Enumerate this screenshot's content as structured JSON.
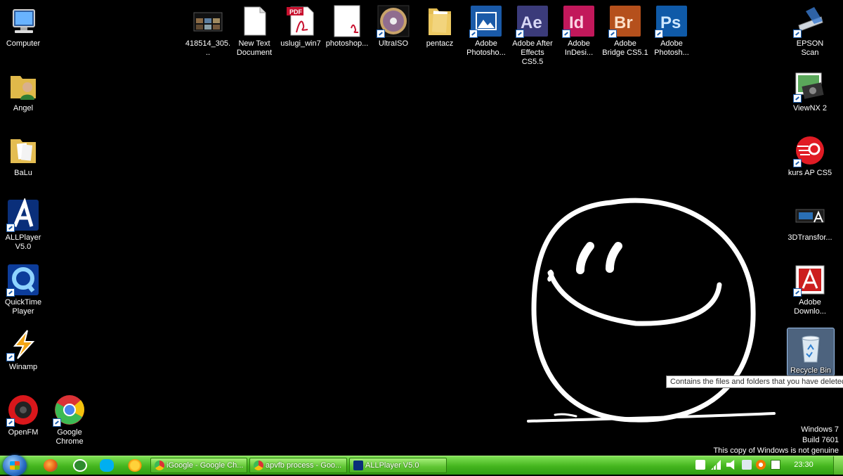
{
  "desktop": {
    "left_icons": [
      {
        "label": "Computer",
        "icon": "computer-icon"
      },
      {
        "label": "Angel",
        "icon": "user-folder-icon"
      },
      {
        "label": "BaLu",
        "icon": "folder-icon"
      },
      {
        "label": "ALLPlayer V5.0",
        "icon": "allplayer-icon"
      },
      {
        "label": "QuickTime Player",
        "icon": "quicktime-icon"
      },
      {
        "label": "Winamp",
        "icon": "winamp-icon"
      },
      {
        "label": "OpenFM",
        "icon": "openfm-icon"
      },
      {
        "label": "Google Chrome",
        "icon": "chrome-icon"
      }
    ],
    "top_icons": [
      {
        "label": "418514_305...",
        "icon": "image-thumbnail-icon"
      },
      {
        "label": "New Text Document",
        "icon": "text-document-icon"
      },
      {
        "label": "uslugi_win7",
        "icon": "pdf-icon"
      },
      {
        "label": "photoshop...",
        "icon": "pdf-document-icon"
      },
      {
        "label": "UltraISO",
        "icon": "ultraiso-disc-icon"
      },
      {
        "label": "pentacz",
        "icon": "folder-icon"
      },
      {
        "label": "Adobe Photosho...",
        "icon": "photoshop-elements-icon"
      },
      {
        "label": "Adobe After Effects CS5.5",
        "icon": "after-effects-icon"
      },
      {
        "label": "Adobe InDesi...",
        "icon": "indesign-icon"
      },
      {
        "label": "Adobe Bridge CS5.1",
        "icon": "bridge-icon"
      },
      {
        "label": "Adobe Photosh...",
        "icon": "photoshop-icon"
      }
    ],
    "right_icons": [
      {
        "label": "EPSON Scan",
        "icon": "scanner-icon"
      },
      {
        "label": "ViewNX 2",
        "icon": "viewnx-icon"
      },
      {
        "label": "kurs AP CS5",
        "icon": "kurs-icon"
      },
      {
        "label": "3DTransfor...",
        "icon": "3dtransform-icon"
      },
      {
        "label": "Adobe Downlo...",
        "icon": "adobe-download-icon"
      },
      {
        "label": "Recycle Bin",
        "icon": "recycle-bin-icon"
      }
    ],
    "tooltip": "Contains the files and folders that you have deleted.",
    "watermark": {
      "line1": "Windows 7",
      "line2": "Build 7601",
      "line3": "This copy of Windows is not genuine"
    }
  },
  "taskbar": {
    "quick_launch": [
      "firefox-icon",
      "utorrent-icon",
      "skype-icon",
      "weather-icon"
    ],
    "tasks": [
      {
        "label": "iGoogle - Google Ch...",
        "icon": "chrome-icon"
      },
      {
        "label": "apvfb process - Goo...",
        "icon": "chrome-icon"
      },
      {
        "label": "ALLPlayer V5.0",
        "icon": "allplayer-icon"
      }
    ],
    "tray": [
      "usb-icon",
      "signal-icon",
      "volume-muted-icon",
      "network-icon",
      "avast-icon",
      "power-icon"
    ],
    "clock": "23:30"
  }
}
